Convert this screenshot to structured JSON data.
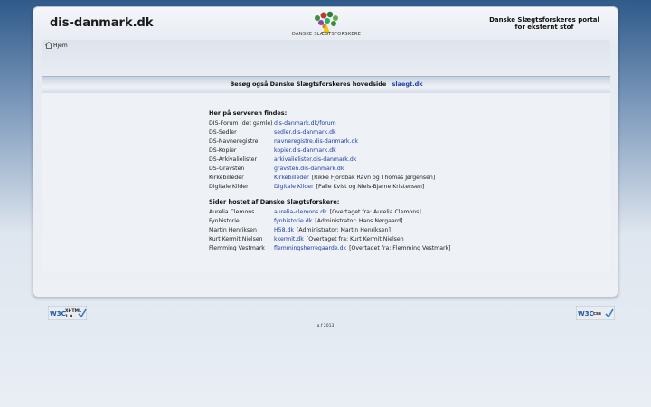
{
  "header": {
    "site_title": "dis-danmark.dk",
    "logo_text": "DANSKE SLÆGTSFORSKERE",
    "portal_text": "Danske Slægtsforskeres portal for eksternt stof"
  },
  "nav": {
    "home_label": "Hjem"
  },
  "banner": {
    "text": "Besøg også Danske Slægtsforskeres hovedside",
    "link": "slaegt.dk"
  },
  "server_section": {
    "title": "Her på serveren findes:",
    "items": [
      {
        "name": "DIS-Forum (det gamle)",
        "link": "dis-danmark.dk/forum",
        "extra": ""
      },
      {
        "name": "DS-Sedler",
        "link": "sedler.dis-danmark.dk",
        "extra": ""
      },
      {
        "name": "DS-Navneregistre",
        "link": "navneregistre.dis-danmark.dk",
        "extra": ""
      },
      {
        "name": "DS-Kopier",
        "link": "kopier.dis-danmark.dk",
        "extra": ""
      },
      {
        "name": "DS-Arkivalielister",
        "link": "arkivalielister.dis-danmark.dk",
        "extra": ""
      },
      {
        "name": "DS-Gravsten",
        "link": "gravsten.dis-danmark.dk",
        "extra": ""
      },
      {
        "name": "Kirkebilleder",
        "link": "Kirkebilleder",
        "extra": "[Rikke Fjordbak Ravn og Thomas Jørgensen]"
      },
      {
        "name": "Digitale Kilder",
        "link": "Digitale Kilder",
        "extra": "[Palle Kvist og Niels-Bjarne Kristensen]"
      }
    ]
  },
  "hosted_section": {
    "title": "Sider hostet af Danske Slægtsforskere:",
    "items": [
      {
        "name": "Aurelia Clemons",
        "link": "aurelia-clemons.dk",
        "extra": "[Overtaget fra: Aurelia Clemons]"
      },
      {
        "name": "Fynhistorie",
        "link": "fynhistorie.dk",
        "extra": "[Administrator: Hans Nørgaard]"
      },
      {
        "name": "Martin Henriksen",
        "link": "H58.dk",
        "extra": "[Administrator: Martin Henriksen]"
      },
      {
        "name": "Kurt Kermit Nielsen",
        "link": "kkermit.dk",
        "extra": "[Overtaget fra: Kurt Kermit Nielsen"
      },
      {
        "name": "Flemming Vestmark",
        "link": "flemmingsherregaarde.dk",
        "extra": "[Overtaget fra: Flemming Vestmark]"
      }
    ]
  },
  "badges": {
    "xhtml": {
      "brand": "W3C",
      "label": "XHTML",
      "version": "1.0"
    },
    "css": {
      "brand": "W3C",
      "label": "css"
    }
  },
  "footer": {
    "text": "a.f 2013"
  },
  "colors": {
    "link": "#1a3fa8",
    "background_top": "#2f5a8a",
    "panel": "#eef1f5"
  }
}
